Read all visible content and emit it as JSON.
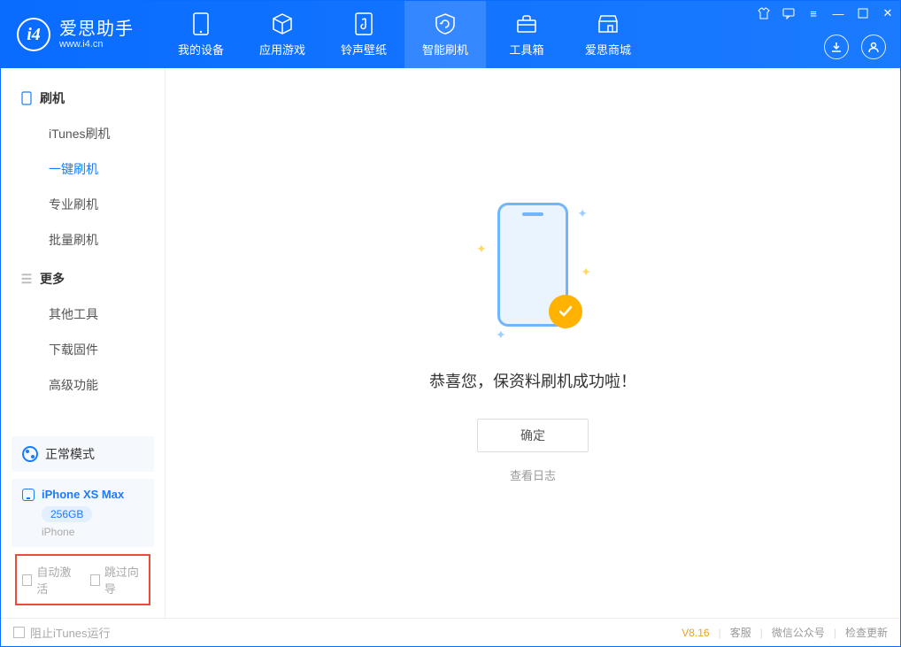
{
  "app": {
    "name": "爱思助手",
    "url": "www.i4.cn"
  },
  "nav": {
    "tabs": [
      {
        "label": "我的设备"
      },
      {
        "label": "应用游戏"
      },
      {
        "label": "铃声壁纸"
      },
      {
        "label": "智能刷机"
      },
      {
        "label": "工具箱"
      },
      {
        "label": "爱思商城"
      }
    ],
    "active_index": 3
  },
  "sidebar": {
    "groups": [
      {
        "title": "刷机",
        "items": [
          {
            "label": "iTunes刷机"
          },
          {
            "label": "一键刷机"
          },
          {
            "label": "专业刷机"
          },
          {
            "label": "批量刷机"
          }
        ],
        "active_index": 1
      },
      {
        "title": "更多",
        "items": [
          {
            "label": "其他工具"
          },
          {
            "label": "下载固件"
          },
          {
            "label": "高级功能"
          }
        ],
        "active_index": -1
      }
    ],
    "mode_label": "正常模式",
    "device": {
      "name": "iPhone XS Max",
      "storage": "256GB",
      "type": "iPhone"
    },
    "options": {
      "auto_activate": "自动激活",
      "skip_guide": "跳过向导"
    }
  },
  "main": {
    "success_text": "恭喜您，保资料刷机成功啦！",
    "ok_button": "确定",
    "view_log": "查看日志"
  },
  "statusbar": {
    "block_itunes": "阻止iTunes运行",
    "version": "V8.16",
    "links": {
      "support": "客服",
      "wechat": "微信公众号",
      "check_update": "检查更新"
    }
  }
}
